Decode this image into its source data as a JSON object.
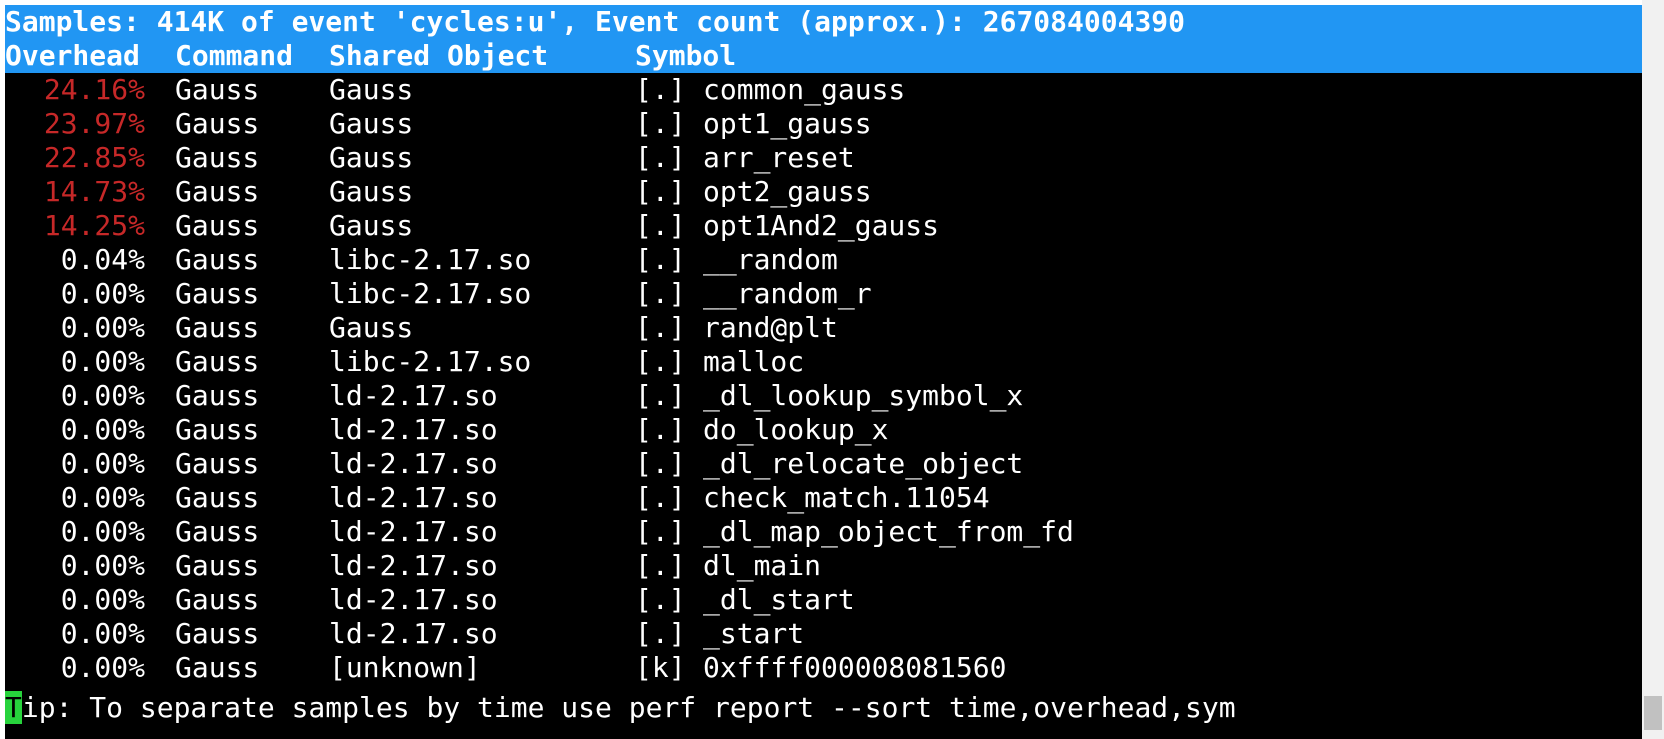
{
  "header": {
    "summary": "Samples: 414K of event 'cycles:u', Event count (approx.): 267084004390",
    "columns": {
      "overhead": "Overhead",
      "command": "Command",
      "shared_object": "Shared Object",
      "symbol": "Symbol"
    }
  },
  "rows": [
    {
      "overhead": "24.16%",
      "command": "Gauss",
      "shared_object": "Gauss",
      "prefix": "[.]",
      "symbol": "common_gauss",
      "hot": true
    },
    {
      "overhead": "23.97%",
      "command": "Gauss",
      "shared_object": "Gauss",
      "prefix": "[.]",
      "symbol": "opt1_gauss",
      "hot": true
    },
    {
      "overhead": "22.85%",
      "command": "Gauss",
      "shared_object": "Gauss",
      "prefix": "[.]",
      "symbol": "arr_reset",
      "hot": true
    },
    {
      "overhead": "14.73%",
      "command": "Gauss",
      "shared_object": "Gauss",
      "prefix": "[.]",
      "symbol": "opt2_gauss",
      "hot": true
    },
    {
      "overhead": "14.25%",
      "command": "Gauss",
      "shared_object": "Gauss",
      "prefix": "[.]",
      "symbol": "opt1And2_gauss",
      "hot": true
    },
    {
      "overhead": "0.04%",
      "command": "Gauss",
      "shared_object": "libc-2.17.so",
      "prefix": "[.]",
      "symbol": "__random",
      "hot": false
    },
    {
      "overhead": "0.00%",
      "command": "Gauss",
      "shared_object": "libc-2.17.so",
      "prefix": "[.]",
      "symbol": "__random_r",
      "hot": false
    },
    {
      "overhead": "0.00%",
      "command": "Gauss",
      "shared_object": "Gauss",
      "prefix": "[.]",
      "symbol": "rand@plt",
      "hot": false
    },
    {
      "overhead": "0.00%",
      "command": "Gauss",
      "shared_object": "libc-2.17.so",
      "prefix": "[.]",
      "symbol": "malloc",
      "hot": false
    },
    {
      "overhead": "0.00%",
      "command": "Gauss",
      "shared_object": "ld-2.17.so",
      "prefix": "[.]",
      "symbol": "_dl_lookup_symbol_x",
      "hot": false
    },
    {
      "overhead": "0.00%",
      "command": "Gauss",
      "shared_object": "ld-2.17.so",
      "prefix": "[.]",
      "symbol": "do_lookup_x",
      "hot": false
    },
    {
      "overhead": "0.00%",
      "command": "Gauss",
      "shared_object": "ld-2.17.so",
      "prefix": "[.]",
      "symbol": "_dl_relocate_object",
      "hot": false
    },
    {
      "overhead": "0.00%",
      "command": "Gauss",
      "shared_object": "ld-2.17.so",
      "prefix": "[.]",
      "symbol": "check_match.11054",
      "hot": false
    },
    {
      "overhead": "0.00%",
      "command": "Gauss",
      "shared_object": "ld-2.17.so",
      "prefix": "[.]",
      "symbol": "_dl_map_object_from_fd",
      "hot": false
    },
    {
      "overhead": "0.00%",
      "command": "Gauss",
      "shared_object": "ld-2.17.so",
      "prefix": "[.]",
      "symbol": "dl_main",
      "hot": false
    },
    {
      "overhead": "0.00%",
      "command": "Gauss",
      "shared_object": "ld-2.17.so",
      "prefix": "[.]",
      "symbol": "_dl_start",
      "hot": false
    },
    {
      "overhead": "0.00%",
      "command": "Gauss",
      "shared_object": "ld-2.17.so",
      "prefix": "[.]",
      "symbol": "_start",
      "hot": false
    },
    {
      "overhead": "0.00%",
      "command": "Gauss",
      "shared_object": "[unknown]",
      "prefix": "[k]",
      "symbol": "0xffff000008081560",
      "hot": false
    }
  ],
  "tip": {
    "first_char": "T",
    "rest": "ip: To separate samples by time use perf report --sort time,overhead,sym"
  },
  "colors": {
    "header_bg": "#2196f3",
    "hot_overhead": "#c62828",
    "cursor": "#27d33c",
    "background": "#000000",
    "text": "#ffffff"
  }
}
